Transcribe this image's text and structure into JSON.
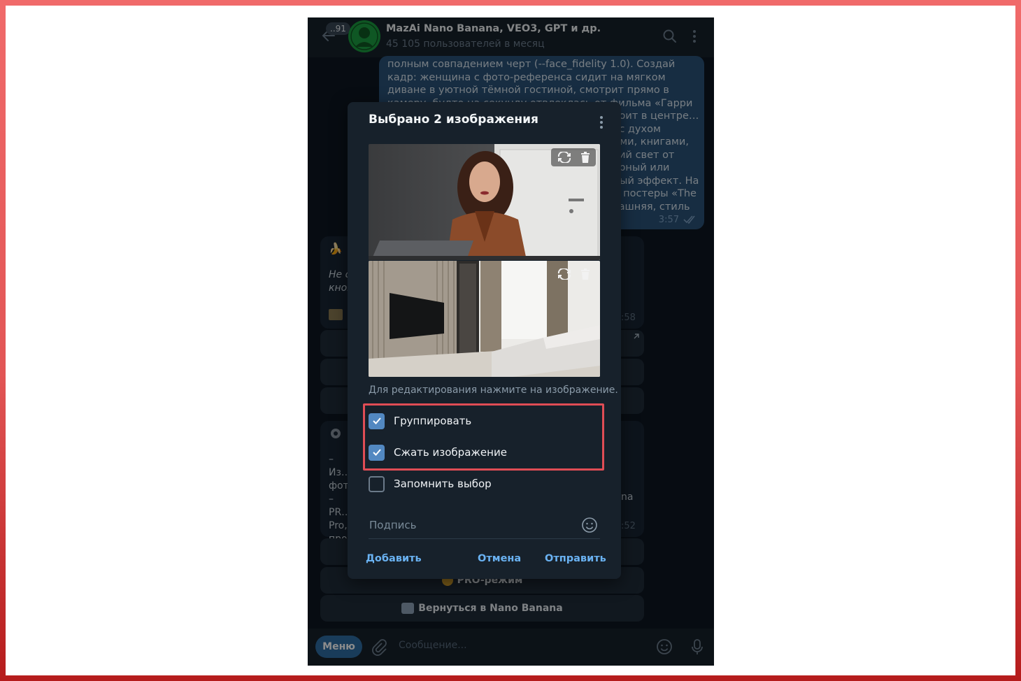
{
  "header": {
    "unread_count": "..91",
    "title": "MazAi Nano Banana, VEO3, GPT и др.",
    "subtitle": "45 105 пользователей в месяц"
  },
  "outgoing_message": {
    "text": "полным совпадением черт (--face_fidelity 1.0). Создай кадр: женщина с фото-референса сидит на мягком диване в уютной тёмной гостиной, смотрит прямо в камеру, будто на секунду отвлеклась от фильма «Гарри Поттер». Ракурс — средний план, диван стоит в центре… должно быть ощущение, что это гостиная с духом Хогвартса. лампа или тёплый свет… полками, книгами, свечами и гирляндами. Освещение — мягкий свет от большого экрана телевизора, тёплый янтарный или тёплый белый свет ламп, создающий уютный эффект. На фоне — полки с книгами, свечи, гирлянды, постеры «The Boy Who Lived». Атмосфера — уютная, домашняя, стиль —",
    "time": "3:57"
  },
  "incoming_messages": [
    {
      "text": "Не с… кноп…",
      "time": ":58"
    },
    {
      "text": "– Из… фото… – PR… Pro,… проп…",
      "extra": "na",
      "time": ":52"
    }
  ],
  "keyboard": {
    "pro_mode": "PRO-режим",
    "back": "Вернуться в Nano Banana"
  },
  "composer": {
    "menu_label": "Меню",
    "placeholder": "Сообщение..."
  },
  "dialog": {
    "title": "Выбрано 2 изображения",
    "hint": "Для редактирования нажмите на изображение.",
    "options": [
      {
        "label": "Группировать",
        "checked": true
      },
      {
        "label": "Сжать изображение",
        "checked": true
      },
      {
        "label": "Запомнить выбор",
        "checked": false
      }
    ],
    "caption_placeholder": "Подпись",
    "buttons": {
      "add": "Добавить",
      "cancel": "Отмена",
      "send": "Отправить"
    }
  },
  "colors": {
    "accent": "#5288c1",
    "link": "#6ab2f2",
    "highlight_border": "#e04d55",
    "chat_background": "#0e1621",
    "outgoing_bubble": "#2b5278"
  }
}
